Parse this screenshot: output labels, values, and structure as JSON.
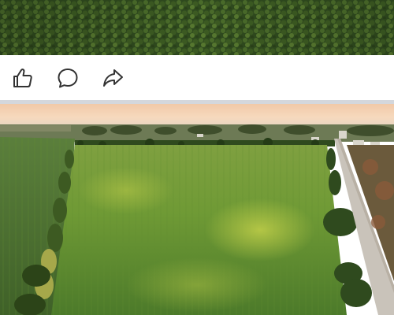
{
  "feed": {
    "posts": [
      {
        "image": {
          "subject": "forest-canopy-photo"
        }
      },
      {
        "image": {
          "subject": "aerial-field-photo"
        }
      }
    ],
    "actions": [
      {
        "name": "like",
        "icon": "thumbs-up-icon"
      },
      {
        "name": "comment",
        "icon": "speech-bubble-icon"
      },
      {
        "name": "share",
        "icon": "share-arrow-icon"
      }
    ]
  },
  "colors": {
    "icon_stroke": "#333333",
    "divider": "#d4d7dc",
    "background": "#ffffff"
  }
}
